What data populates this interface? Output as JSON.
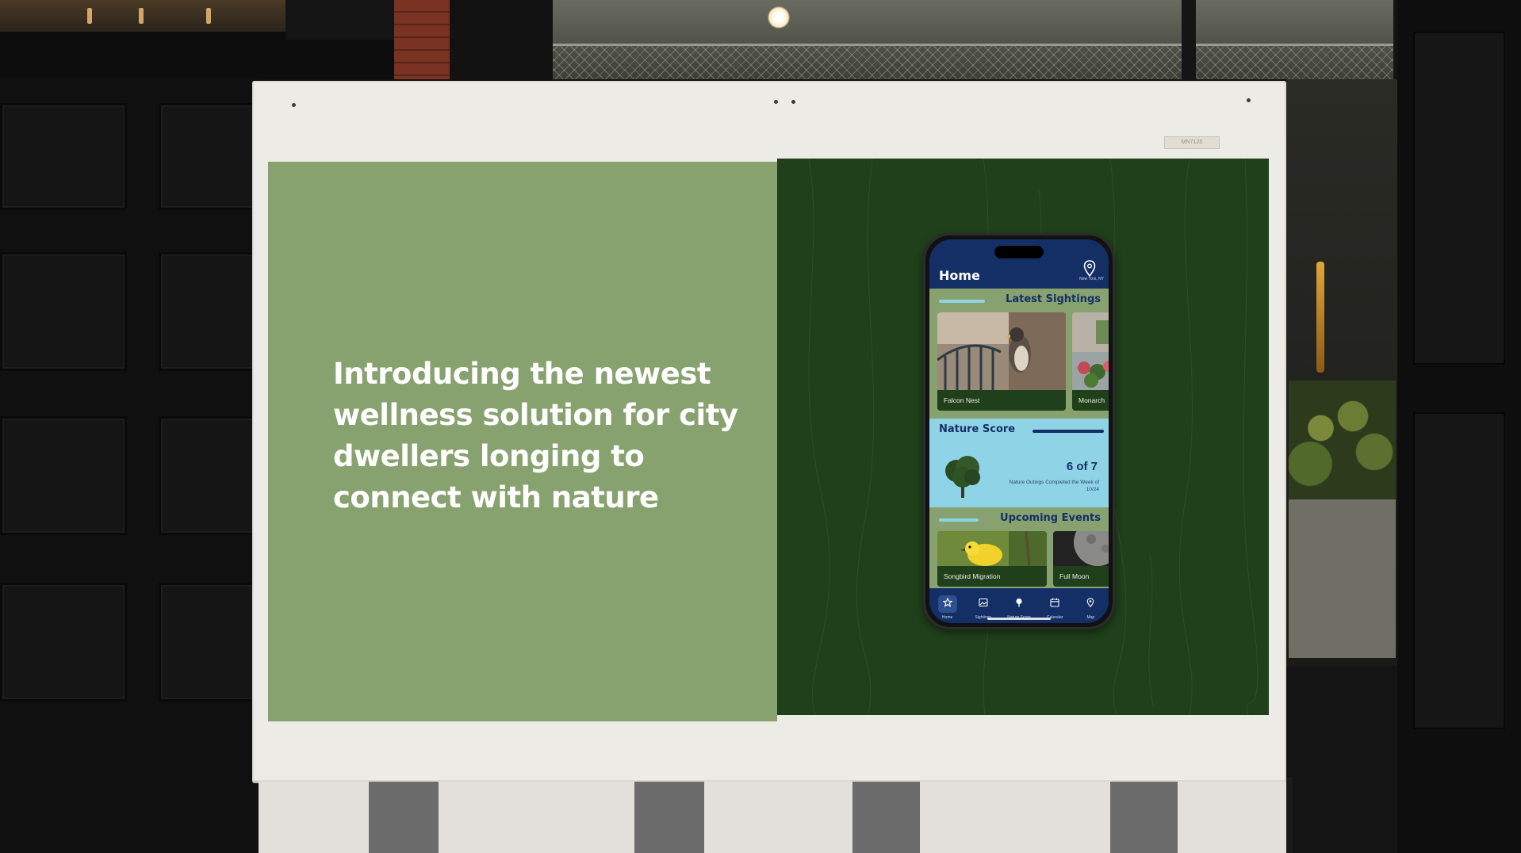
{
  "billboard": {
    "headline": "Introducing the newest wellness solution for city dwellers longing to connect with nature",
    "colors": {
      "left_panel": "#87a26f",
      "right_panel": "#203f1b",
      "frame": "#ecebe6"
    }
  },
  "app": {
    "header": {
      "title": "Home",
      "location": "New York, NY",
      "location_icon": "map-pin-icon"
    },
    "latest_sightings": {
      "title": "Latest Sightings",
      "items": [
        {
          "label": "Falcon Nest",
          "photo": "falcon-on-balcony"
        },
        {
          "label": "Monarch",
          "photo": "flowers-building"
        }
      ]
    },
    "nature_score": {
      "title": "Nature Score",
      "value": "6 of 7",
      "caption": "Nature Outings Completed the Week of 10/24",
      "icon": "tree-icon"
    },
    "upcoming_events": {
      "title": "Upcoming Events",
      "items": [
        {
          "label": "Songbird Migration",
          "photo": "yellow-warbler"
        },
        {
          "label": "Full Moon",
          "photo": "moon"
        }
      ]
    },
    "nav": [
      {
        "label": "Home",
        "icon": "star-icon",
        "active": true
      },
      {
        "label": "Sightings",
        "icon": "image-icon",
        "active": false
      },
      {
        "label": "Nature Score",
        "icon": "tree-icon",
        "active": false
      },
      {
        "label": "Calendar",
        "icon": "calendar-icon",
        "active": false
      },
      {
        "label": "Map",
        "icon": "map-pin-icon",
        "active": false
      }
    ],
    "colors": {
      "navy": "#142f66",
      "sage": "#87a26f",
      "sky": "#8fd3e6",
      "forest": "#203f1b"
    }
  },
  "frame_tag": "MN7125"
}
